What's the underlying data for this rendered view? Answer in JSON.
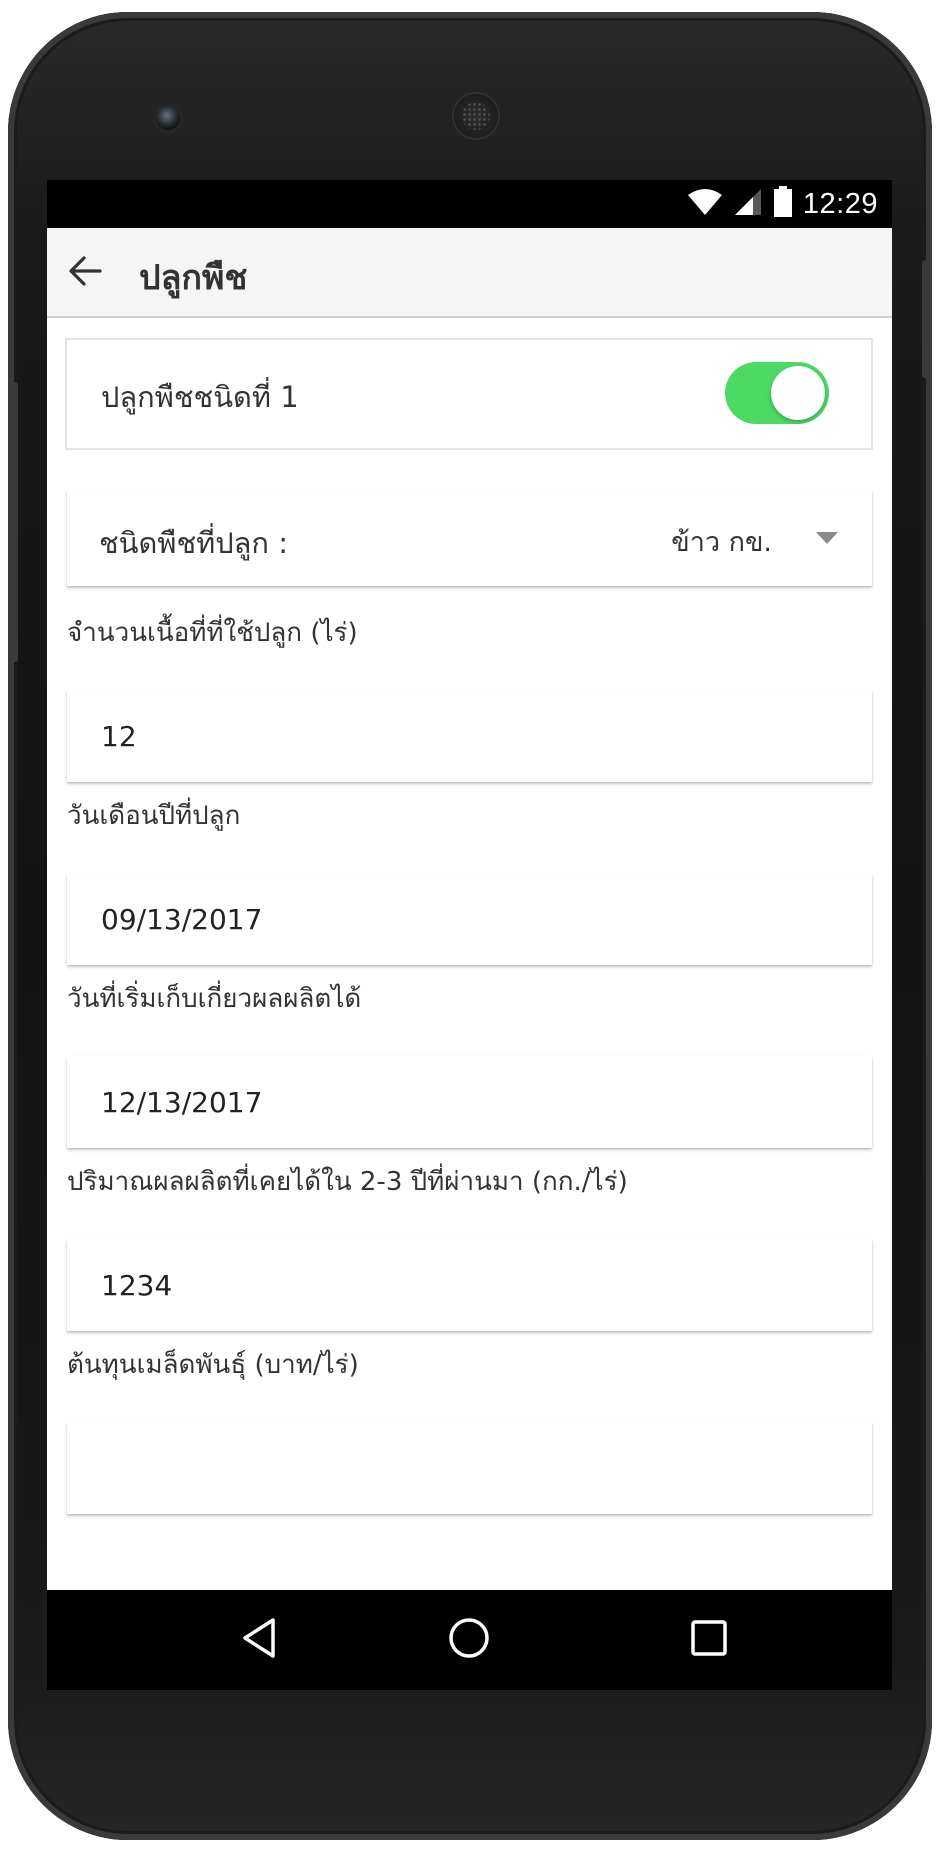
{
  "status_bar": {
    "time": "12:29",
    "icons": [
      "wifi-icon",
      "signal-icon",
      "battery-icon"
    ]
  },
  "toolbar": {
    "title": "ปลูกพืช",
    "back_icon": "arrow-back-icon"
  },
  "crop_toggle": {
    "label": "ปลูกพืชชนิดที่ 1",
    "enabled": true,
    "color": "#4cd964"
  },
  "crop_type": {
    "label": "ชนิดพืชที่ปลูก :",
    "value": "ข้าว กข."
  },
  "fields": [
    {
      "label": "จำนวนเนื้อที่ที่ใช้ปลูก (ไร่)",
      "value": "12"
    },
    {
      "label": "วันเดือนปีที่ปลูก",
      "value": "09/13/2017"
    },
    {
      "label": "วันที่เริ่มเก็บเกี่ยวผลผลิตได้",
      "value": "12/13/2017"
    },
    {
      "label": "ปริมาณผลผลิตที่เคยได้ใน 2-3 ปีที่ผ่านมา (กก./ไร่)",
      "value": "1234"
    },
    {
      "label": "ต้นทุนเมล็ดพันธุ์ (บาท/ไร่)",
      "value": ""
    }
  ],
  "nav_bar": {
    "icons": [
      "nav-back-icon",
      "nav-home-icon",
      "nav-recents-icon"
    ]
  }
}
